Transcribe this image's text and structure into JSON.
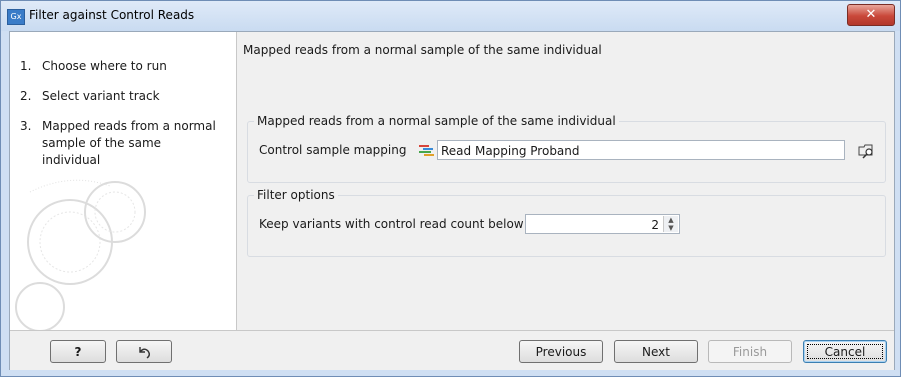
{
  "window": {
    "title": "Filter against Control Reads",
    "app_icon_text": "Gx",
    "close_symbol": "✕"
  },
  "steps": [
    {
      "num": "1.",
      "label": "Choose where to run"
    },
    {
      "num": "2.",
      "label": "Select variant track"
    },
    {
      "num": "3.",
      "label": "Mapped reads from a normal sample of the same individual"
    }
  ],
  "main": {
    "header": "Mapped reads from a normal sample of the same individual",
    "group_mapping": {
      "legend": "Mapped reads from a normal sample of the same individual",
      "field_label": "Control sample mapping",
      "field_value": "Read Mapping Proband"
    },
    "group_filter": {
      "legend": "Filter options",
      "field_label": "Keep variants with control read count below",
      "field_value": "2"
    }
  },
  "buttons": {
    "help": "?",
    "previous": "Previous",
    "next": "Next",
    "finish": "Finish",
    "cancel": "Cancel"
  },
  "colors": {
    "accent": "#3a7cc8",
    "close": "#c9483a"
  }
}
